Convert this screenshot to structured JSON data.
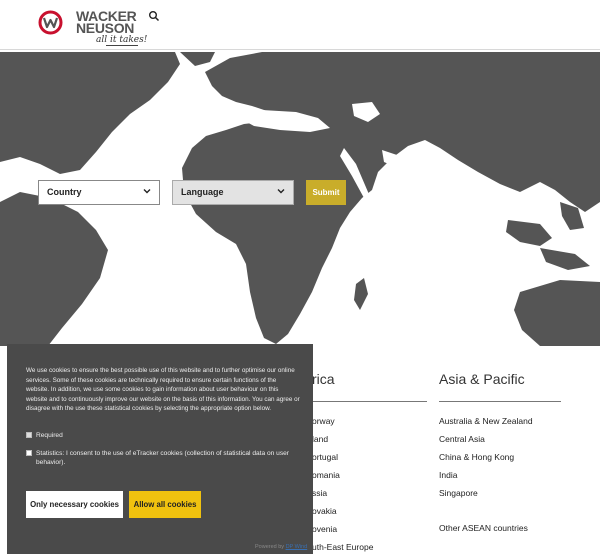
{
  "brand": {
    "name_line1": "WACKER",
    "name_line2": "NEUSON",
    "tagline": "all it takes!",
    "icon": "wacker-neuson-logo-mark",
    "accent_red": "#c8102e",
    "submit_gold": "#c9ad2a",
    "cookie_yellow": "#f0c20f"
  },
  "header": {
    "search_icon": "search-icon"
  },
  "selector": {
    "country_label": "Country",
    "language_label": "Language",
    "submit_label": "Submit"
  },
  "regions": [
    {
      "title": "rica",
      "items": [
        "orway",
        "land",
        "ortugal",
        "omania",
        "ssia",
        "ovakia",
        "ovenia",
        "uth-East Europe"
      ]
    },
    {
      "title": "Asia & Pacific",
      "items": [
        "Australia & New Zealand",
        "Central Asia",
        "China & Hong Kong",
        "India",
        "Singapore",
        "Other ASEAN countries"
      ]
    }
  ],
  "cookie": {
    "text": "We use cookies to ensure the best possible use of this website and to further optimise our online services. Some of these cookies are technically required to ensure certain functions of the website. In addition, we use some cookies to gain information about user behaviour on this website and to continuously improve our website on the basis of this information. You can agree or disagree with the use these statistical cookies by selecting the appropriate option below.",
    "required_label": "Required",
    "statistics_label": "Statistics: I consent to the use of eTracker cookies (collection of statistical data on user behavior).",
    "btn_necessary": "Only necessary cookies",
    "btn_all": "Allow all cookies",
    "powered_prefix": "Powered by",
    "powered_link": "DP Wind"
  }
}
